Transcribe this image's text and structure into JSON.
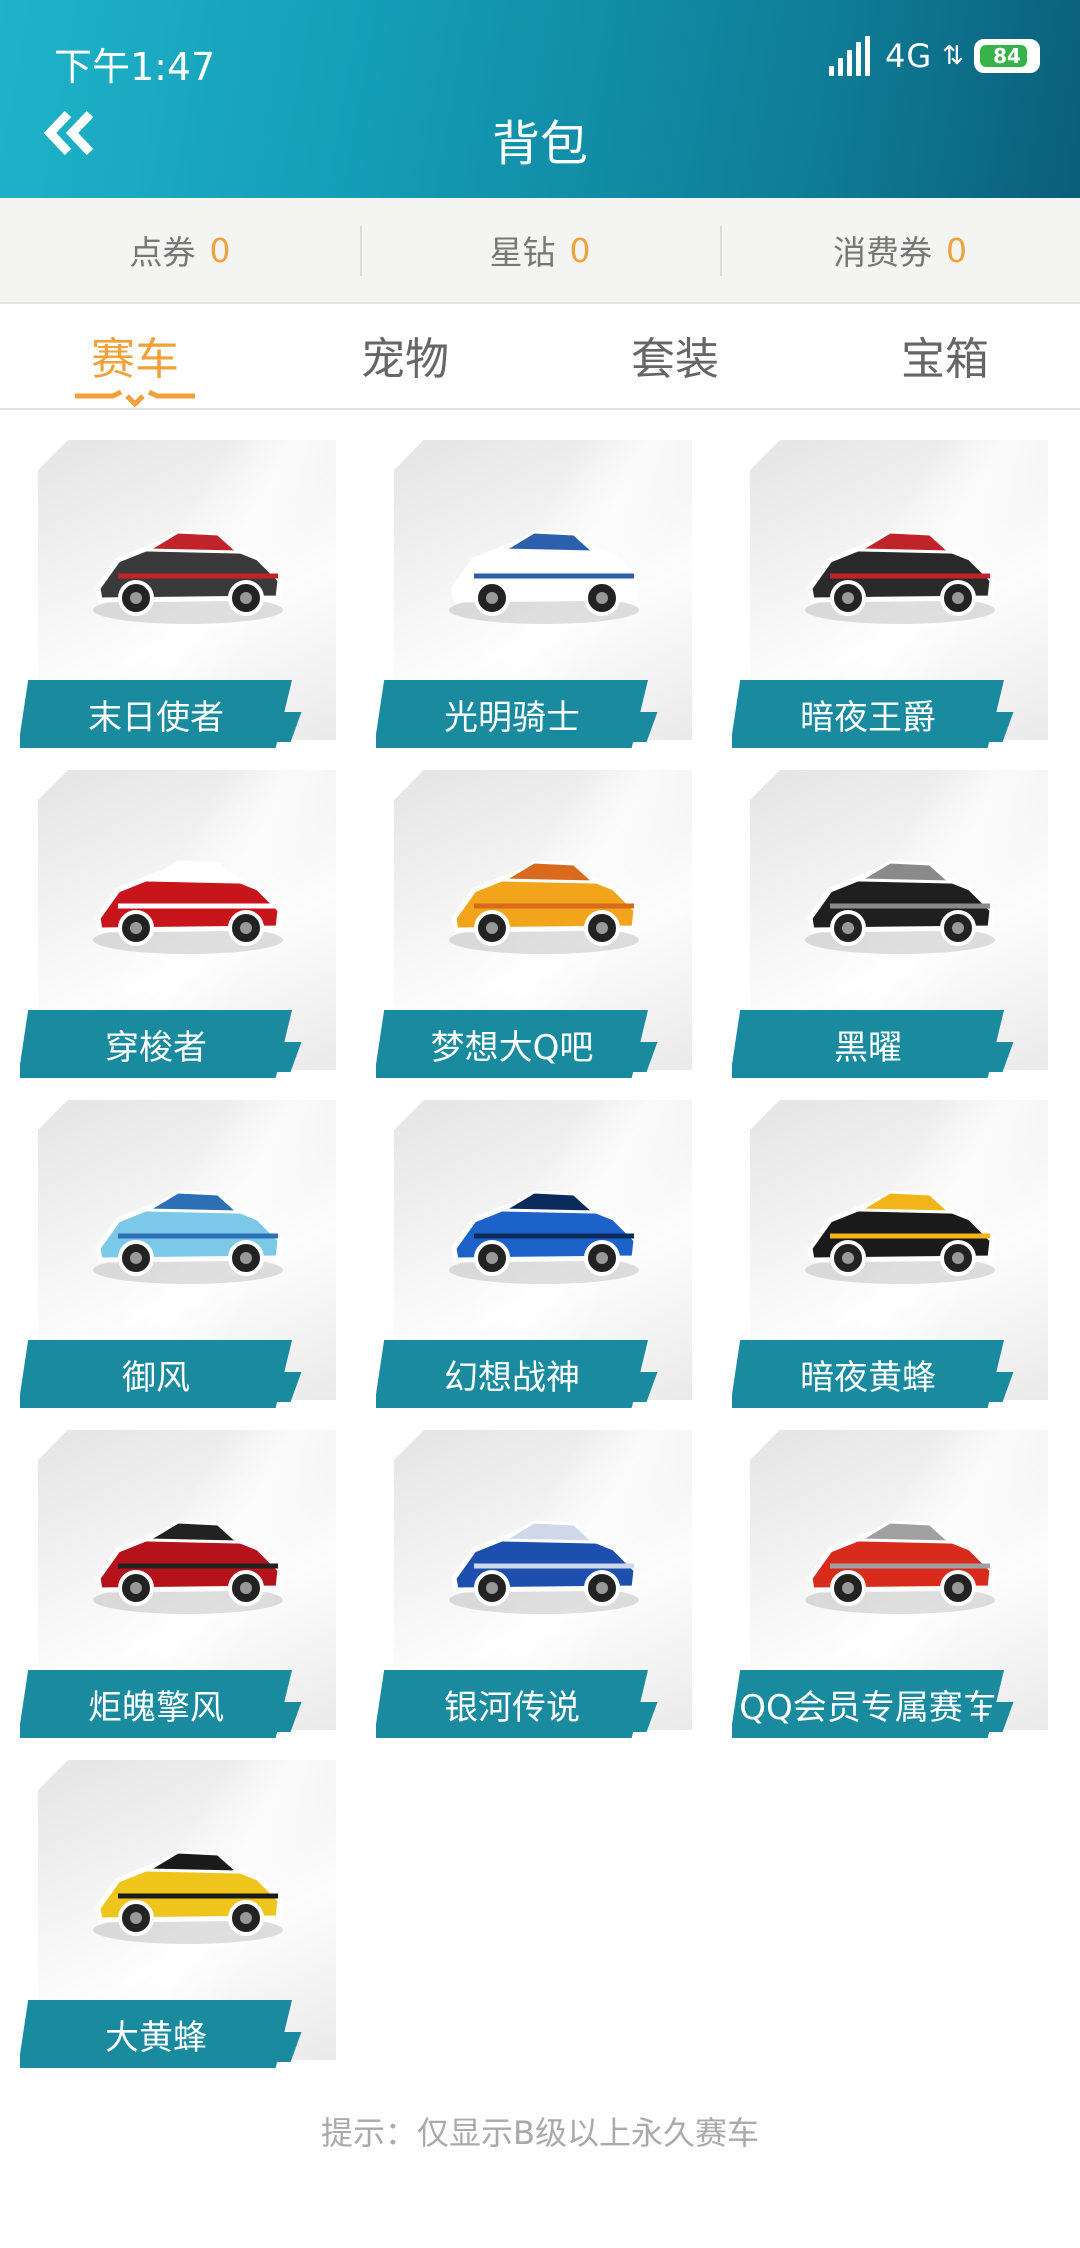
{
  "status_bar": {
    "time": "下午1:47",
    "network": "4G",
    "battery": "84"
  },
  "header": {
    "title": "背包"
  },
  "currencies": [
    {
      "name": "点券",
      "value": "0"
    },
    {
      "name": "星钻",
      "value": "0"
    },
    {
      "name": "消费券",
      "value": "0"
    }
  ],
  "tabs": [
    {
      "label": "赛车",
      "active": true
    },
    {
      "label": "宠物",
      "active": false
    },
    {
      "label": "套装",
      "active": false
    },
    {
      "label": "宝箱",
      "active": false
    }
  ],
  "items": [
    {
      "name": "末日使者",
      "color": "#3a3a3a",
      "accent": "#c0242a"
    },
    {
      "name": "光明骑士",
      "color": "#ffffff",
      "accent": "#2c5fae"
    },
    {
      "name": "暗夜王爵",
      "color": "#2a2a2a",
      "accent": "#c0242a"
    },
    {
      "name": "穿梭者",
      "color": "#c8141b",
      "accent": "#ffffff"
    },
    {
      "name": "梦想大Q吧",
      "color": "#f2a41b",
      "accent": "#d96a1b"
    },
    {
      "name": "黑曜",
      "color": "#1f1f1f",
      "accent": "#8a8a8a"
    },
    {
      "name": "御风",
      "color": "#7cc8e8",
      "accent": "#2d6fb5"
    },
    {
      "name": "幻想战神",
      "color": "#1c62c9",
      "accent": "#0b2a5c"
    },
    {
      "name": "暗夜黄蜂",
      "color": "#1a1a1a",
      "accent": "#f1b51a"
    },
    {
      "name": "炬魄擎风",
      "color": "#b5121b",
      "accent": "#222222"
    },
    {
      "name": "银河传说",
      "color": "#1d4fae",
      "accent": "#cfd8e8"
    },
    {
      "name": "QQ会员专属赛车",
      "color": "#d92b1c",
      "accent": "#a0a0a0"
    },
    {
      "name": "大黄蜂",
      "color": "#f0c51b",
      "accent": "#1a1a1a"
    }
  ],
  "hint": "提示：仅显示B级以上永久赛车"
}
